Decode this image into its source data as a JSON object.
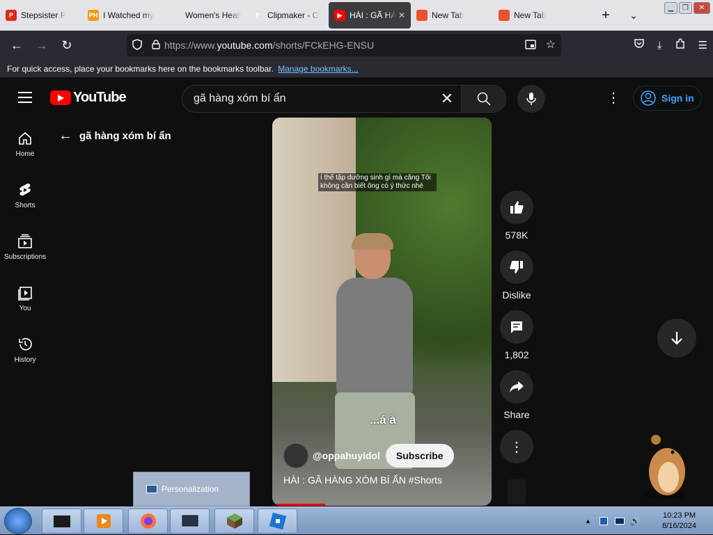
{
  "browser": {
    "tabs": [
      {
        "title": "Stepsister P",
        "fav_color": "#e0261b",
        "fav_text": "P"
      },
      {
        "title": "I Watched my",
        "fav_color": "#f39a12",
        "fav_text": "PH"
      },
      {
        "title": "Women's Health -",
        "fav_color": "#e3e3e8",
        "fav_text": ""
      },
      {
        "title": "Clipmaker - O",
        "fav_color": "#e3e3e8",
        "fav_text": "P"
      },
      {
        "title": "HÀI : GÃ HÀ",
        "fav_color": "#ff0000",
        "fav_text": "▶"
      },
      {
        "title": "New Tab",
        "fav_color": "#e8532d",
        "fav_text": ""
      },
      {
        "title": "New Tab",
        "fav_color": "#e8532d",
        "fav_text": ""
      }
    ],
    "url_prefix": "https://www.",
    "url_domain": "youtube.com",
    "url_path": "/shorts/FCkEHG-ENSU",
    "bookmarks_msg": "For quick access, place your bookmarks here on the bookmarks toolbar.",
    "bookmarks_link": "Manage bookmarks..."
  },
  "youtube": {
    "logo_text": "YouTube",
    "search_query": "gã hàng xóm bí ẩn",
    "signin": "Sign in",
    "sidebar": [
      {
        "label": "Home"
      },
      {
        "label": "Shorts"
      },
      {
        "label": "Subscriptions"
      },
      {
        "label": "You"
      },
      {
        "label": "History"
      }
    ],
    "back_title": "gã hàng xóm bí ẩn",
    "video": {
      "caption": "í thế tập dưỡng sinh gì mà căng Tôi không cần biết ông có ý thức nhé",
      "overlay_text": "...á à",
      "channel": "@oppahuyidol",
      "subscribe": "Subscribe",
      "title": "HÀI : GÃ HÀNG XÓM BÍ ẨN #Shorts"
    },
    "actions": {
      "likes": "578K",
      "dislike": "Dislike",
      "comments": "1,802",
      "share": "Share"
    }
  },
  "desktop": {
    "personalization": "Personalization",
    "clock_time": "10:23 PM",
    "clock_date": "8/16/2024"
  }
}
